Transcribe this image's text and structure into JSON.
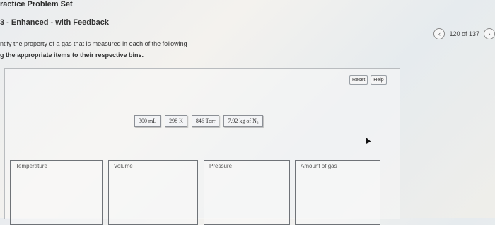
{
  "header": {
    "title": "ractice Problem Set",
    "subtitle": "3 - Enhanced - with Feedback"
  },
  "nav": {
    "prev_icon": "‹",
    "count": "120 of 137",
    "next_icon": "›"
  },
  "instructions": {
    "line1": "ntify the property of a gas that is measured in each of the following",
    "line2": "g the appropriate items to their respective bins."
  },
  "controls": {
    "reset_label": "Reset",
    "help_label": "Help"
  },
  "tiles": [
    {
      "label": "300 mL"
    },
    {
      "label": "298 K"
    },
    {
      "label": "846 Torr"
    },
    {
      "label": "7.92 kg of N₂"
    }
  ],
  "bins": [
    {
      "label": "Temperature"
    },
    {
      "label": "Volume"
    },
    {
      "label": "Pressure"
    },
    {
      "label": "Amount of gas"
    }
  ]
}
